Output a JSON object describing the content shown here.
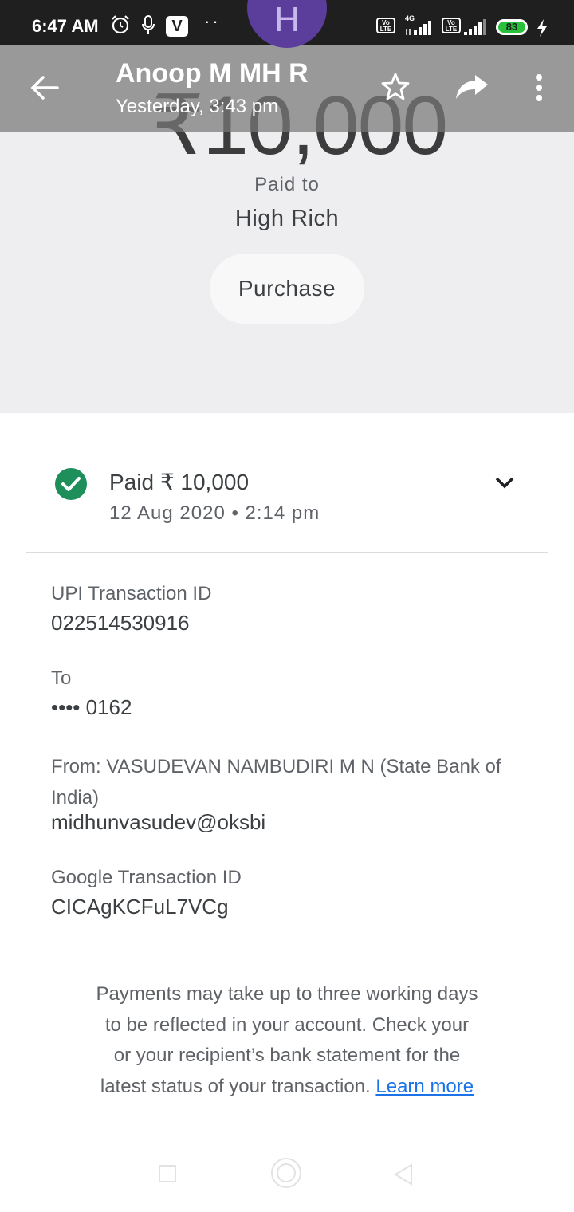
{
  "status_bar": {
    "time": "6:47 AM",
    "app_icon_letter": "V",
    "overflow_dots": "··",
    "network_type": "4G",
    "volte_label_top": "Vo",
    "volte_label_bottom": "LTE",
    "battery_level": "83",
    "icons": [
      "alarm-icon",
      "mic-icon",
      "signal-icon",
      "battery-icon",
      "charging-bolt-icon"
    ]
  },
  "header": {
    "contact_name": "Anoop M MH R",
    "subtitle": "Yesterday, 3:43 pm",
    "avatar_letter": "H",
    "icons": [
      "back-arrow-icon",
      "star-icon",
      "share-icon",
      "more-vert-icon"
    ]
  },
  "hero": {
    "amount": "₹10,000",
    "paid_to_label": "Paid to",
    "payee": "High Rich",
    "note": "Purchase"
  },
  "status": {
    "line": "Paid ₹ 10,000",
    "date": "12 Aug 2020 • 2:14 pm"
  },
  "details": {
    "upi_label": "UPI Transaction ID",
    "upi_value": "022514530916",
    "to_label": "To",
    "to_value": "•••• 0162",
    "from_label": "From: VASUDEVAN NAMBUDIRI  M N (State Bank of India)",
    "from_value": "midhunvasudev@oksbi",
    "google_label": "Google Transaction ID",
    "google_value": "CICAgKCFuL7VCg"
  },
  "footer": {
    "note": "Payments may take up to three working days to be reflected in your account. Check your or your recipient’s bank statement for the latest status of your transaction.",
    "learn_more": "Learn more"
  },
  "colors": {
    "success_green": "#1e8e5a",
    "link_blue": "#1a73e8",
    "avatar_purple": "#5b3e9c"
  }
}
